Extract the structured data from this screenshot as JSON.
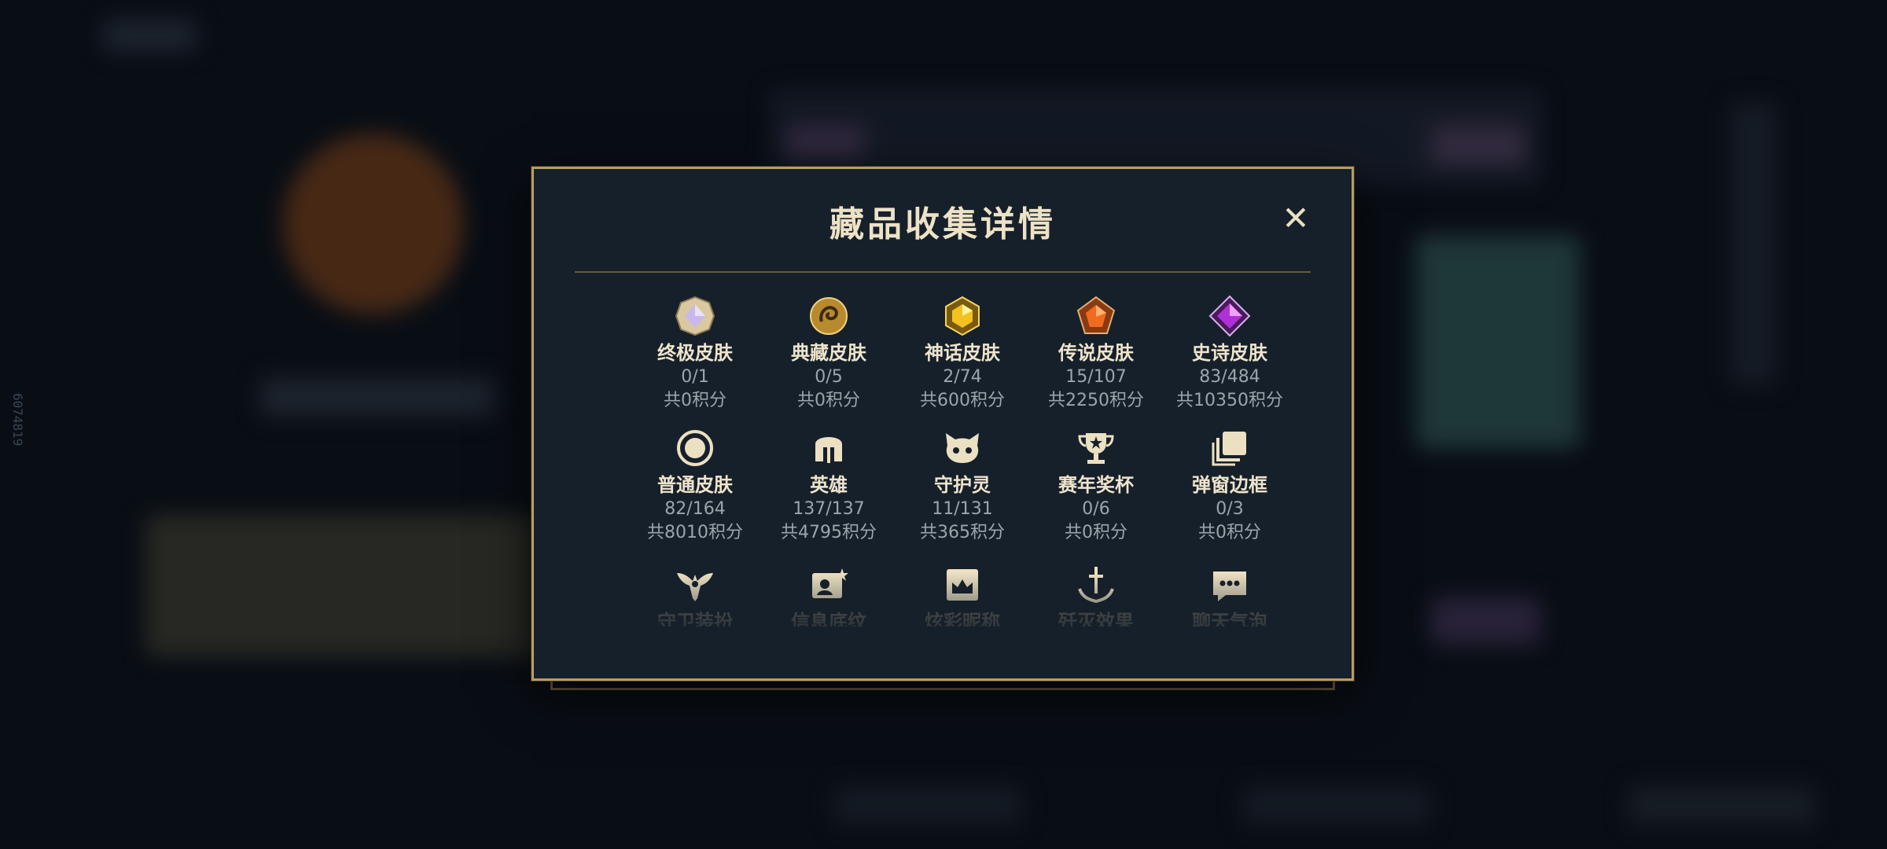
{
  "modal": {
    "title": "藏品收集详情",
    "close_label": "✕"
  },
  "side_id": "6074819",
  "colors": {
    "accent_gold": "#b69d63",
    "panel": "#16202a",
    "title_text": "#ede2c6",
    "muted_text": "#9da4ab"
  },
  "items": [
    {
      "name": "终极皮肤",
      "count": "0/1",
      "points": "共0积分",
      "icon": "ultimate-skin-icon"
    },
    {
      "name": "典藏皮肤",
      "count": "0/5",
      "points": "共0积分",
      "icon": "collector-skin-icon"
    },
    {
      "name": "神话皮肤",
      "count": "2/74",
      "points": "共600积分",
      "icon": "mythic-skin-icon"
    },
    {
      "name": "传说皮肤",
      "count": "15/107",
      "points": "共2250积分",
      "icon": "legendary-skin-icon"
    },
    {
      "name": "史诗皮肤",
      "count": "83/484",
      "points": "共10350积分",
      "icon": "epic-skin-icon"
    },
    {
      "name": "普通皮肤",
      "count": "82/164",
      "points": "共8010积分",
      "icon": "standard-skin-icon"
    },
    {
      "name": "英雄",
      "count": "137/137",
      "points": "共4795积分",
      "icon": "champion-helmet-icon"
    },
    {
      "name": "守护灵",
      "count": "11/131",
      "points": "共365积分",
      "icon": "guardian-pet-icon"
    },
    {
      "name": "赛年奖杯",
      "count": "0/6",
      "points": "共0积分",
      "icon": "trophy-icon"
    },
    {
      "name": "弹窗边框",
      "count": "0/3",
      "points": "共0积分",
      "icon": "frame-icon"
    },
    {
      "name": "守卫装扮",
      "icon": "ward-skin-icon"
    },
    {
      "name": "信息底纹",
      "icon": "profile-banner-icon"
    },
    {
      "name": "炫彩昵称",
      "icon": "nickname-icon"
    },
    {
      "name": "歼灭效果",
      "icon": "finisher-icon"
    },
    {
      "name": "聊天气泡",
      "icon": "chat-bubble-icon"
    }
  ]
}
